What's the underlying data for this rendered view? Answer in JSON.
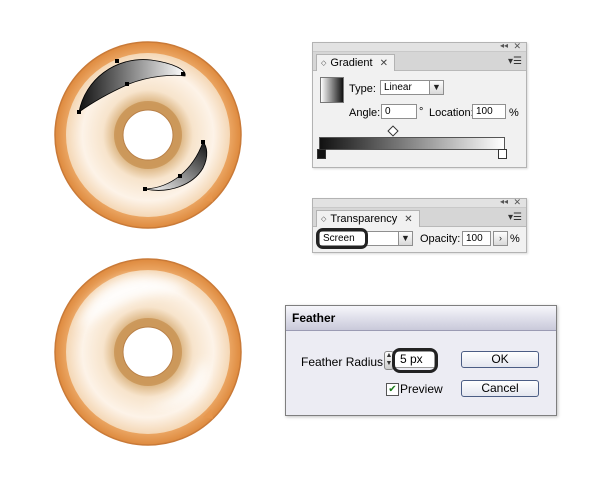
{
  "gradient_panel": {
    "tab_title": "Gradient",
    "type_label": "Type:",
    "type_value": "Linear",
    "angle_label": "Angle:",
    "angle_value": "0",
    "degree_symbol": "°",
    "location_label": "Location:",
    "location_value": "100",
    "percent_symbol": "%"
  },
  "transparency_panel": {
    "tab_title": "Transparency",
    "blend_mode": "Screen",
    "opacity_label": "Opacity:",
    "opacity_value": "100",
    "percent_symbol": "%"
  },
  "feather_dialog": {
    "title": "Feather",
    "radius_label": "Feather Radius:",
    "radius_value": "5 px",
    "ok_label": "OK",
    "cancel_label": "Cancel",
    "preview_label": "Preview",
    "preview_checked": true
  },
  "colors": {
    "donut_crust": "#e89848",
    "donut_icing": "#fbeedd",
    "gradient_dark": "#1a1a1a",
    "highlight_outline": "#222222"
  },
  "icons": [
    "panel-menu-icon",
    "close-icon",
    "collapse-icon",
    "dropdown-arrow-icon",
    "stepper-icon",
    "checkbox-icon"
  ]
}
